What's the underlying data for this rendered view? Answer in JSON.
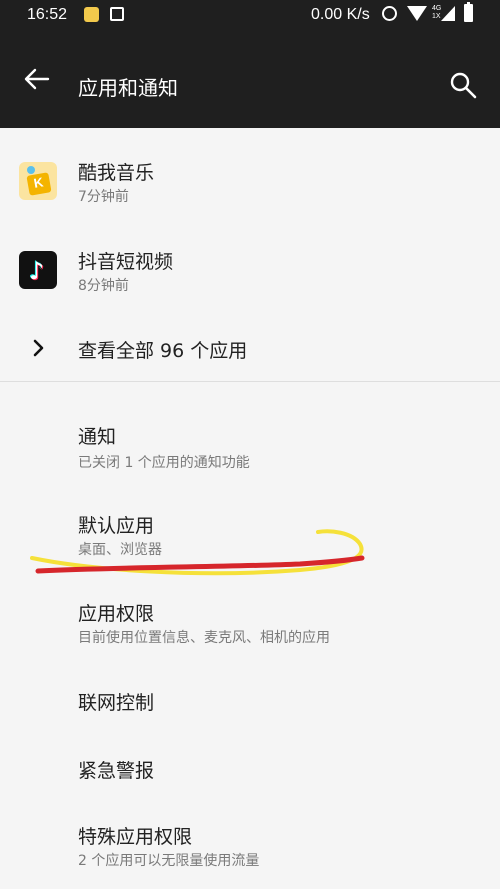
{
  "status_bar": {
    "time": "16:52",
    "net_speed": "0.00 K/s",
    "net_label_top": "4G",
    "net_label_bottom": "1X",
    "icons": [
      "app-notification-icon",
      "image-notification-icon",
      "alarm-icon",
      "wifi-icon",
      "signal-icon",
      "battery-icon"
    ]
  },
  "app_bar": {
    "title": "应用和通知",
    "back_icon": "arrow-left-icon",
    "search_icon": "search-icon"
  },
  "recent_apps": [
    {
      "name": "酷我音乐",
      "time": "7分钟前",
      "icon": "kuwo-music-icon"
    },
    {
      "name": "抖音短视频",
      "time": "8分钟前",
      "icon": "tiktok-icon"
    }
  ],
  "see_all": {
    "label": "查看全部 96 个应用",
    "icon": "chevron-right-icon"
  },
  "settings": [
    {
      "title": "通知",
      "summary": "已关闭 1 个应用的通知功能"
    },
    {
      "title": "默认应用",
      "summary": "桌面、浏览器"
    },
    {
      "title": "应用权限",
      "summary": "目前使用位置信息、麦克风、相机的应用"
    },
    {
      "title": "联网控制",
      "summary": ""
    },
    {
      "title": "紧急警报",
      "summary": ""
    },
    {
      "title": "特殊应用权限",
      "summary": "2 个应用可以无限量使用流量"
    }
  ],
  "colors": {
    "bar_background": "#1f1f1f",
    "page_background": "#f5f5f5",
    "scribble_yellow": "#f5e13a",
    "scribble_red": "#d6262b"
  }
}
